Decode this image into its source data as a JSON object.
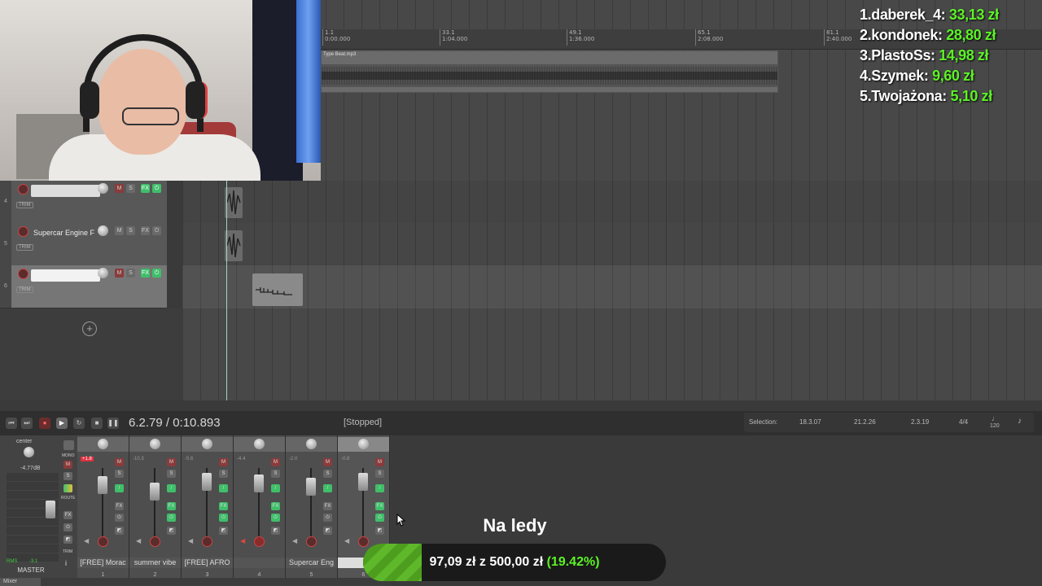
{
  "leaderboard": [
    {
      "rank": "1.",
      "name": "daberek_4:",
      "amount": "33,13 zł"
    },
    {
      "rank": "2.",
      "name": "kondonek:",
      "amount": "28,80 zł"
    },
    {
      "rank": "3.",
      "name": "PlastoSs:",
      "amount": "14,98 zł"
    },
    {
      "rank": "4.",
      "name": "Szymek:",
      "amount": "9,60 zł"
    },
    {
      "rank": "5.",
      "name": "Twojażona:",
      "amount": "5,10 zł"
    }
  ],
  "ruler": {
    "marks": [
      "1.1",
      "33.1",
      "49.1",
      "65.1",
      "81.1"
    ],
    "times": [
      "0:00.000",
      "1:04.000",
      "1:36.000",
      "2:08.000",
      "2:40.000"
    ]
  },
  "clip_name": "Type Beat.mp3",
  "tracks": [
    {
      "number": "4",
      "name": "",
      "fx": "FX",
      "trim": "TRIM"
    },
    {
      "number": "5",
      "name": "Supercar Engine F",
      "fx": "FX",
      "trim": "TRIM"
    },
    {
      "number": "6",
      "name": "",
      "fx": "FX",
      "trim": "TRIM"
    }
  ],
  "transport": {
    "position": "6.2.79 / 0:10.893",
    "status": "[Stopped]",
    "selection_label": "Selection:",
    "selection_start": "18.3.07",
    "selection_end": "21.2.26",
    "selection_length": "2.3.19",
    "time_sig": "4/4",
    "bpm": "120"
  },
  "mixer": {
    "master_label": "MASTER",
    "pan_label": "center",
    "master_db": "-4.77dB",
    "rms_label": "RMS",
    "rms_value": "-3.1",
    "mono_label": "MONO",
    "route_label": "ROUTE",
    "trim_label": "TRIM",
    "strips": [
      {
        "name": "[FREE] Morac",
        "number": "1",
        "peak": "+1.8"
      },
      {
        "name": "summer vibe",
        "number": "2",
        "peak": "-10.3"
      },
      {
        "name": "[FREE] AFRO ",
        "number": "3",
        "peak": "-5.6"
      },
      {
        "name": "",
        "number": "4",
        "peak": "-4.4"
      },
      {
        "name": "Supercar Eng",
        "number": "5",
        "peak": "-2.0"
      },
      {
        "name": "",
        "number": "6",
        "peak": "-0.8"
      }
    ],
    "tab_label": "Mixer"
  },
  "goal": {
    "title": "Na ledy",
    "current": "97,09 zł",
    "separator": "z",
    "target": "500,00 zł",
    "percent": "(19.42%)",
    "fraction": 0.1942
  },
  "colors": {
    "accent_green": "#5cf226",
    "goal_fill": "#5fb82a",
    "fx_green": "#3fbf6a"
  }
}
